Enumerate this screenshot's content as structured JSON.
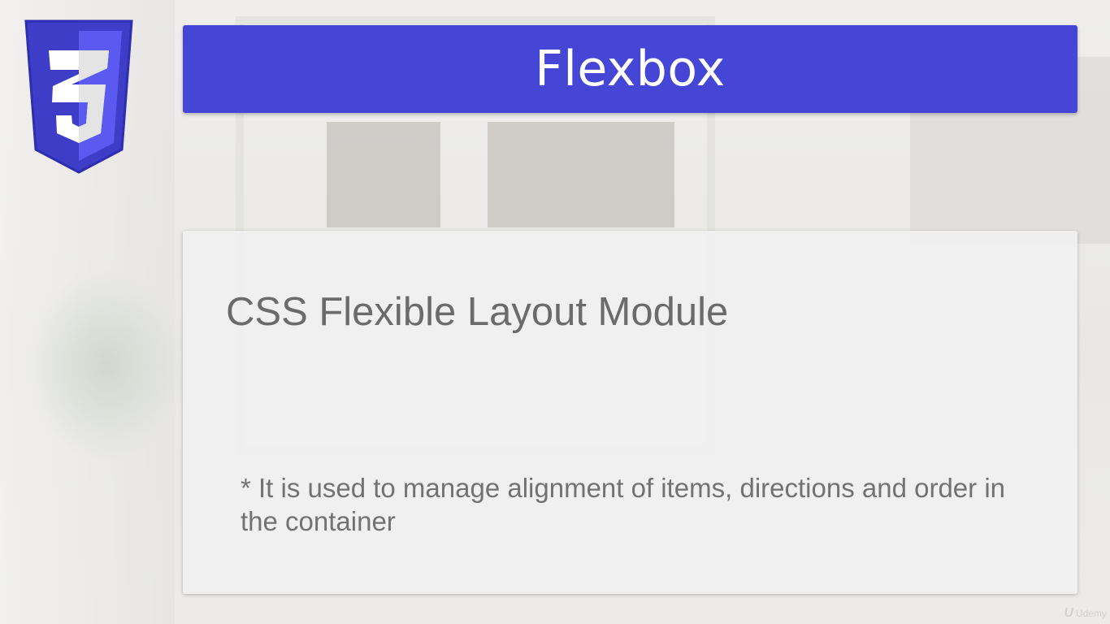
{
  "slide": {
    "title": "Flexbox",
    "heading": "CSS Flexible Layout Module",
    "note": "* It is used to manage alignment of items, directions and order in the container"
  },
  "logo": {
    "icon": "css3-shield-icon",
    "glyph": "3",
    "colors": {
      "shield_dark": "#3d3dc8",
      "shield_light": "#5a5af0",
      "glyph": "#ffffff",
      "glyph_shade": "#e4e4e4"
    }
  },
  "watermark": {
    "icon": "udemy-icon",
    "text": "Udemy"
  },
  "colors": {
    "title_bar": "#4646d6",
    "title_text": "#ffffff",
    "card_background": "#f0f0f1",
    "card_text": "#6b6b6b"
  }
}
